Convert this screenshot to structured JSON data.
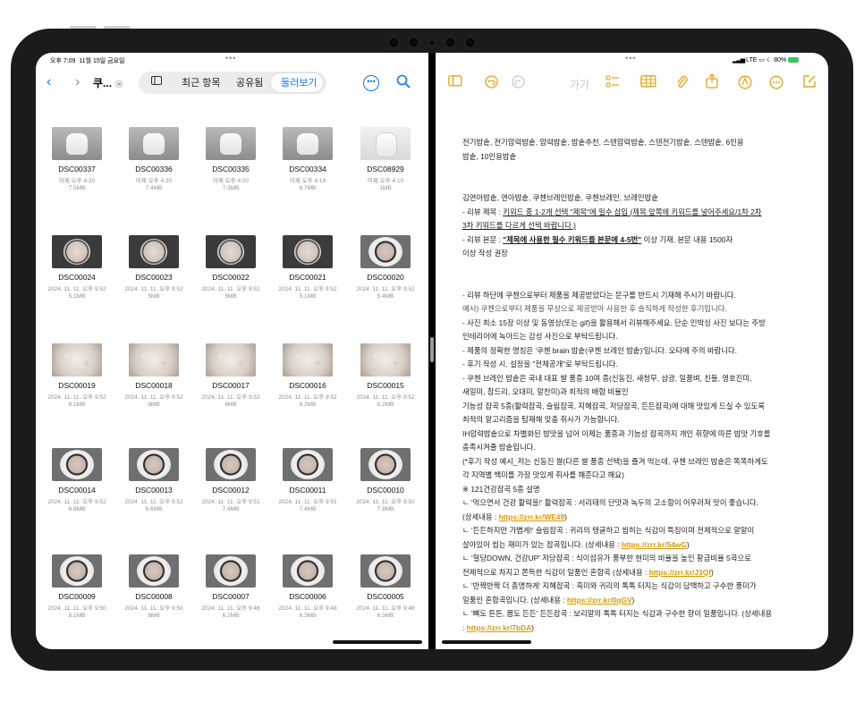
{
  "status_left": {
    "time": "오후 7:09",
    "date": "11월 15일 금요일"
  },
  "status_right": {
    "network": "LTE",
    "battery": "80%"
  },
  "files": {
    "title": "쿠...",
    "tabs": [
      "최근 항목",
      "공유됨",
      "둘러보기"
    ],
    "active_tab": "둘러보기",
    "items": [
      {
        "name": "DSC00337",
        "date": "어제 오후 4:20",
        "size": "7.5MB",
        "thumb": "cooker"
      },
      {
        "name": "DSC00336",
        "date": "어제 오후 4:20",
        "size": "7.4MB",
        "thumb": "cooker"
      },
      {
        "name": "DSC00335",
        "date": "어제 오후 4:20",
        "size": "7.3MB",
        "thumb": "cooker"
      },
      {
        "name": "DSC00334",
        "date": "어제 오후 4:19",
        "size": "6.7MB",
        "thumb": "cooker"
      },
      {
        "name": "DSC08929",
        "date": "어제 오후 4:10",
        "size": "1MB",
        "thumb": "white"
      },
      {
        "name": "DSC00024",
        "date": "2024. 11. 11. 오후 9:52",
        "size": "5.1MB",
        "thumb": "dark"
      },
      {
        "name": "DSC00023",
        "date": "2024. 11. 11. 오후 9:52",
        "size": "5MB",
        "thumb": "dark"
      },
      {
        "name": "DSC00022",
        "date": "2024. 11. 11. 오후 9:52",
        "size": "5MB",
        "thumb": "dark"
      },
      {
        "name": "DSC00021",
        "date": "2024. 11. 11. 오후 9:52",
        "size": "5.1MB",
        "thumb": "dark"
      },
      {
        "name": "DSC00020",
        "date": "2024. 11. 11. 오후 9:52",
        "size": "5.4MB",
        "thumb": "pot"
      },
      {
        "name": "DSC00019",
        "date": "2024. 11. 11. 오후 9:52",
        "size": "6.1MB",
        "thumb": "rice"
      },
      {
        "name": "DSC00018",
        "date": "2024. 11. 11. 오후 9:52",
        "size": "6MB",
        "thumb": "rice"
      },
      {
        "name": "DSC00017",
        "date": "2024. 11. 11. 오후 9:52",
        "size": "6MB",
        "thumb": "rice"
      },
      {
        "name": "DSC00016",
        "date": "2024. 11. 11. 오후 9:52",
        "size": "6.2MB",
        "thumb": "rice"
      },
      {
        "name": "DSC00015",
        "date": "2024. 11. 11. 오후 9:52",
        "size": "6.2MB",
        "thumb": "rice"
      },
      {
        "name": "DSC00014",
        "date": "2024. 11. 11. 오후 9:52",
        "size": "6.9MB",
        "thumb": "pot"
      },
      {
        "name": "DSC00013",
        "date": "2024. 11. 11. 오후 9:52",
        "size": "6.6MB",
        "thumb": "pot"
      },
      {
        "name": "DSC00012",
        "date": "2024. 11. 11. 오후 9:51",
        "size": "7.4MB",
        "thumb": "pot"
      },
      {
        "name": "DSC00011",
        "date": "2024. 11. 11. 오후 9:51",
        "size": "7.4MB",
        "thumb": "pot"
      },
      {
        "name": "DSC00010",
        "date": "2024. 11. 11. 오후 9:50",
        "size": "7.9MB",
        "thumb": "pot"
      },
      {
        "name": "DSC00009",
        "date": "2024. 11. 11. 오후 9:50",
        "size": "8.1MB",
        "thumb": "pot"
      },
      {
        "name": "DSC00008",
        "date": "2024. 11. 11. 오후 9:50",
        "size": "8MB",
        "thumb": "pot"
      },
      {
        "name": "DSC00007",
        "date": "2024. 11. 11. 오후 9:48",
        "size": "6.2MB",
        "thumb": "pot"
      },
      {
        "name": "DSC00006",
        "date": "2024. 11. 11. 오후 9:48",
        "size": "6.3MB",
        "thumb": "pot"
      },
      {
        "name": "DSC00005",
        "date": "2024. 11. 11. 오후 9:48",
        "size": "6.3MB",
        "thumb": "pot"
      }
    ]
  },
  "notes": {
    "format_label": "가가",
    "lines": {
      "l1": "전기밥솥, 전기압력밥솥, 압력밥솥, 밥솥추천, 스텐압력밥솥, 스텐전기밥솥, 스텐밥솥, 6인용",
      "l2": "밥솥, 10인용밥솥",
      "l3": "김연아밥솥, 연아밥솥, 쿠첸브레인밥솥, 쿠첸브레인, 브레인밥솥",
      "l4a": "- 리뷰 제목 : ",
      "l4b": "키워드 중 1-2개 선택 \"제목\"에 필수 삽입 (제목 앞쪽에 키워드를 넣어주세요/1차 2차",
      "l5": "3차 키워드를 다르게 선택 바랍니다.)",
      "l6a": "- 리뷰 본문 : ",
      "l6b": "\"제목에 사용한 필수 키워드를 본문에 4-5번\"",
      "l6c": " 이상 기재, 본문 내용 1500자",
      "l7": "이상 작성 권장",
      "l8": "- 리뷰 하단에 쿠첸으로부터 제품을 제공받았다는 문구를 반드시 기재해 주시기 바랍니다.",
      "l9": "  예시) 쿠첸으로부터 제품을 무상으로 제공받아 사용한 후 솔직하게 작성한 후기입니다.",
      "l10": "- 사진 최소 15장 이상 및 동영상(또는 gif)을 활용해서 리뷰해주세요. 단순 인박싱 사진 보다는 주방",
      "l11": "인테리어에 녹아드는 감성 사진으로 부탁드립니다.",
      "l12": "- 제품의 정확한 명칭은 '쿠첸 brain 밥솥(쿠첸 브레인 밥솥)'입니다. 오타에 주의 바랍니다.",
      "l13": "- 후기 작성 시, 설정을 \"전체공개\"로 부탁드립니다.",
      "l14": "- 쿠첸 브레인 밥솥은 국내 대표 쌀 품종 10여 종(신동진, 새청무, 삼광, 일품벼, 친들, 영호진미,",
      "l15": "새일미, 참드리, 오대미, 알찬미)과 최적의 배합 비율인",
      "l16": " 기능성 잡곡 5종(활력잡곡, 슬림잡곡, 지혜잡곡, 저당잡곡, 든든잡곡)에 대해 맛있게 드실 수 있도록",
      "l17": "최적의 알고리즘을 탑재해 맞춤 취사가 가능합니다.",
      "l18": " IH압력밥솥으로 차별화된 밥맛을 넘어 이제는 품종과 기능성 잡곡까지 개인 취향에 따른 밥맛 기호를",
      "l19": "충족시켜줄 밥솥입니다.",
      "l20": " (*후기 작성 예시_저는 신동진 쌀(다른 쌀 품종 선택)을 즐겨 먹는데, 쿠첸 브레인 밥솥은 똑똑하게도",
      "l21": "각 지역별 백미를 가장 맛있게 취사를 해준다고 해요)",
      "l22": "※ 121건강잡곡 5종 설명",
      "l23": "  ㄴ '먹으면서 건강 활력을!' 활력잡곡 : 서리태의 단맛과 녹두의 고소함이 어우러져 맛이 좋습니다.",
      "l24a": "(상세내용 : ",
      "l24b": "https://zrr.kr/WE49",
      "l24c": ")",
      "l25": "  ㄴ '든든하지만 가볍게!' 슬림잡곡 : 귀리의 탱글하고 씹히는 식감이 특징이며 전체적으로 알알이",
      "l26a": "살아있어 씹는 재미가 있는 잡곡입니다. (상세내용 : ",
      "l26b": "https://zrr.kr/54wG",
      "l26c": ")",
      "l27": "  ㄴ '혈당DOWN, 건강UP' 저당잡곡 : 식이섬유가 풍부한 현미의 비율을 높인 황금비율 5곡으로",
      "l28a": "전체적으로 차지고 쫀득한 식감이 일품인 혼합곡 (상세내용 : ",
      "l28b": "https://zrr.kr/J3Qf",
      "l28c": ")",
      "l29": "  ㄴ '반짝반짝 더 총명하게' 지혜잡곡 : 흑미와 귀리의 톡톡 터지는 식감이 담백하고 구수한 풍미가",
      "l30a": "일품인 혼합곡입니다. (상세내용 : ",
      "l30b": "https://zrr.kr/0qGV",
      "l30c": ")",
      "l31": "  ㄴ '뼈도 튼튼, 몸도 든든' 든든잡곡 : 보리알의 톡톡 터지는 식감과 구수한 향이 일품입니다. (상세내용",
      "l32a": ": ",
      "l32b": "https://zrr.kr/7bDA",
      "l32c": ")"
    }
  },
  "colors": {
    "files_accent": "#0a7aff",
    "notes_accent": "#e6a51a"
  }
}
